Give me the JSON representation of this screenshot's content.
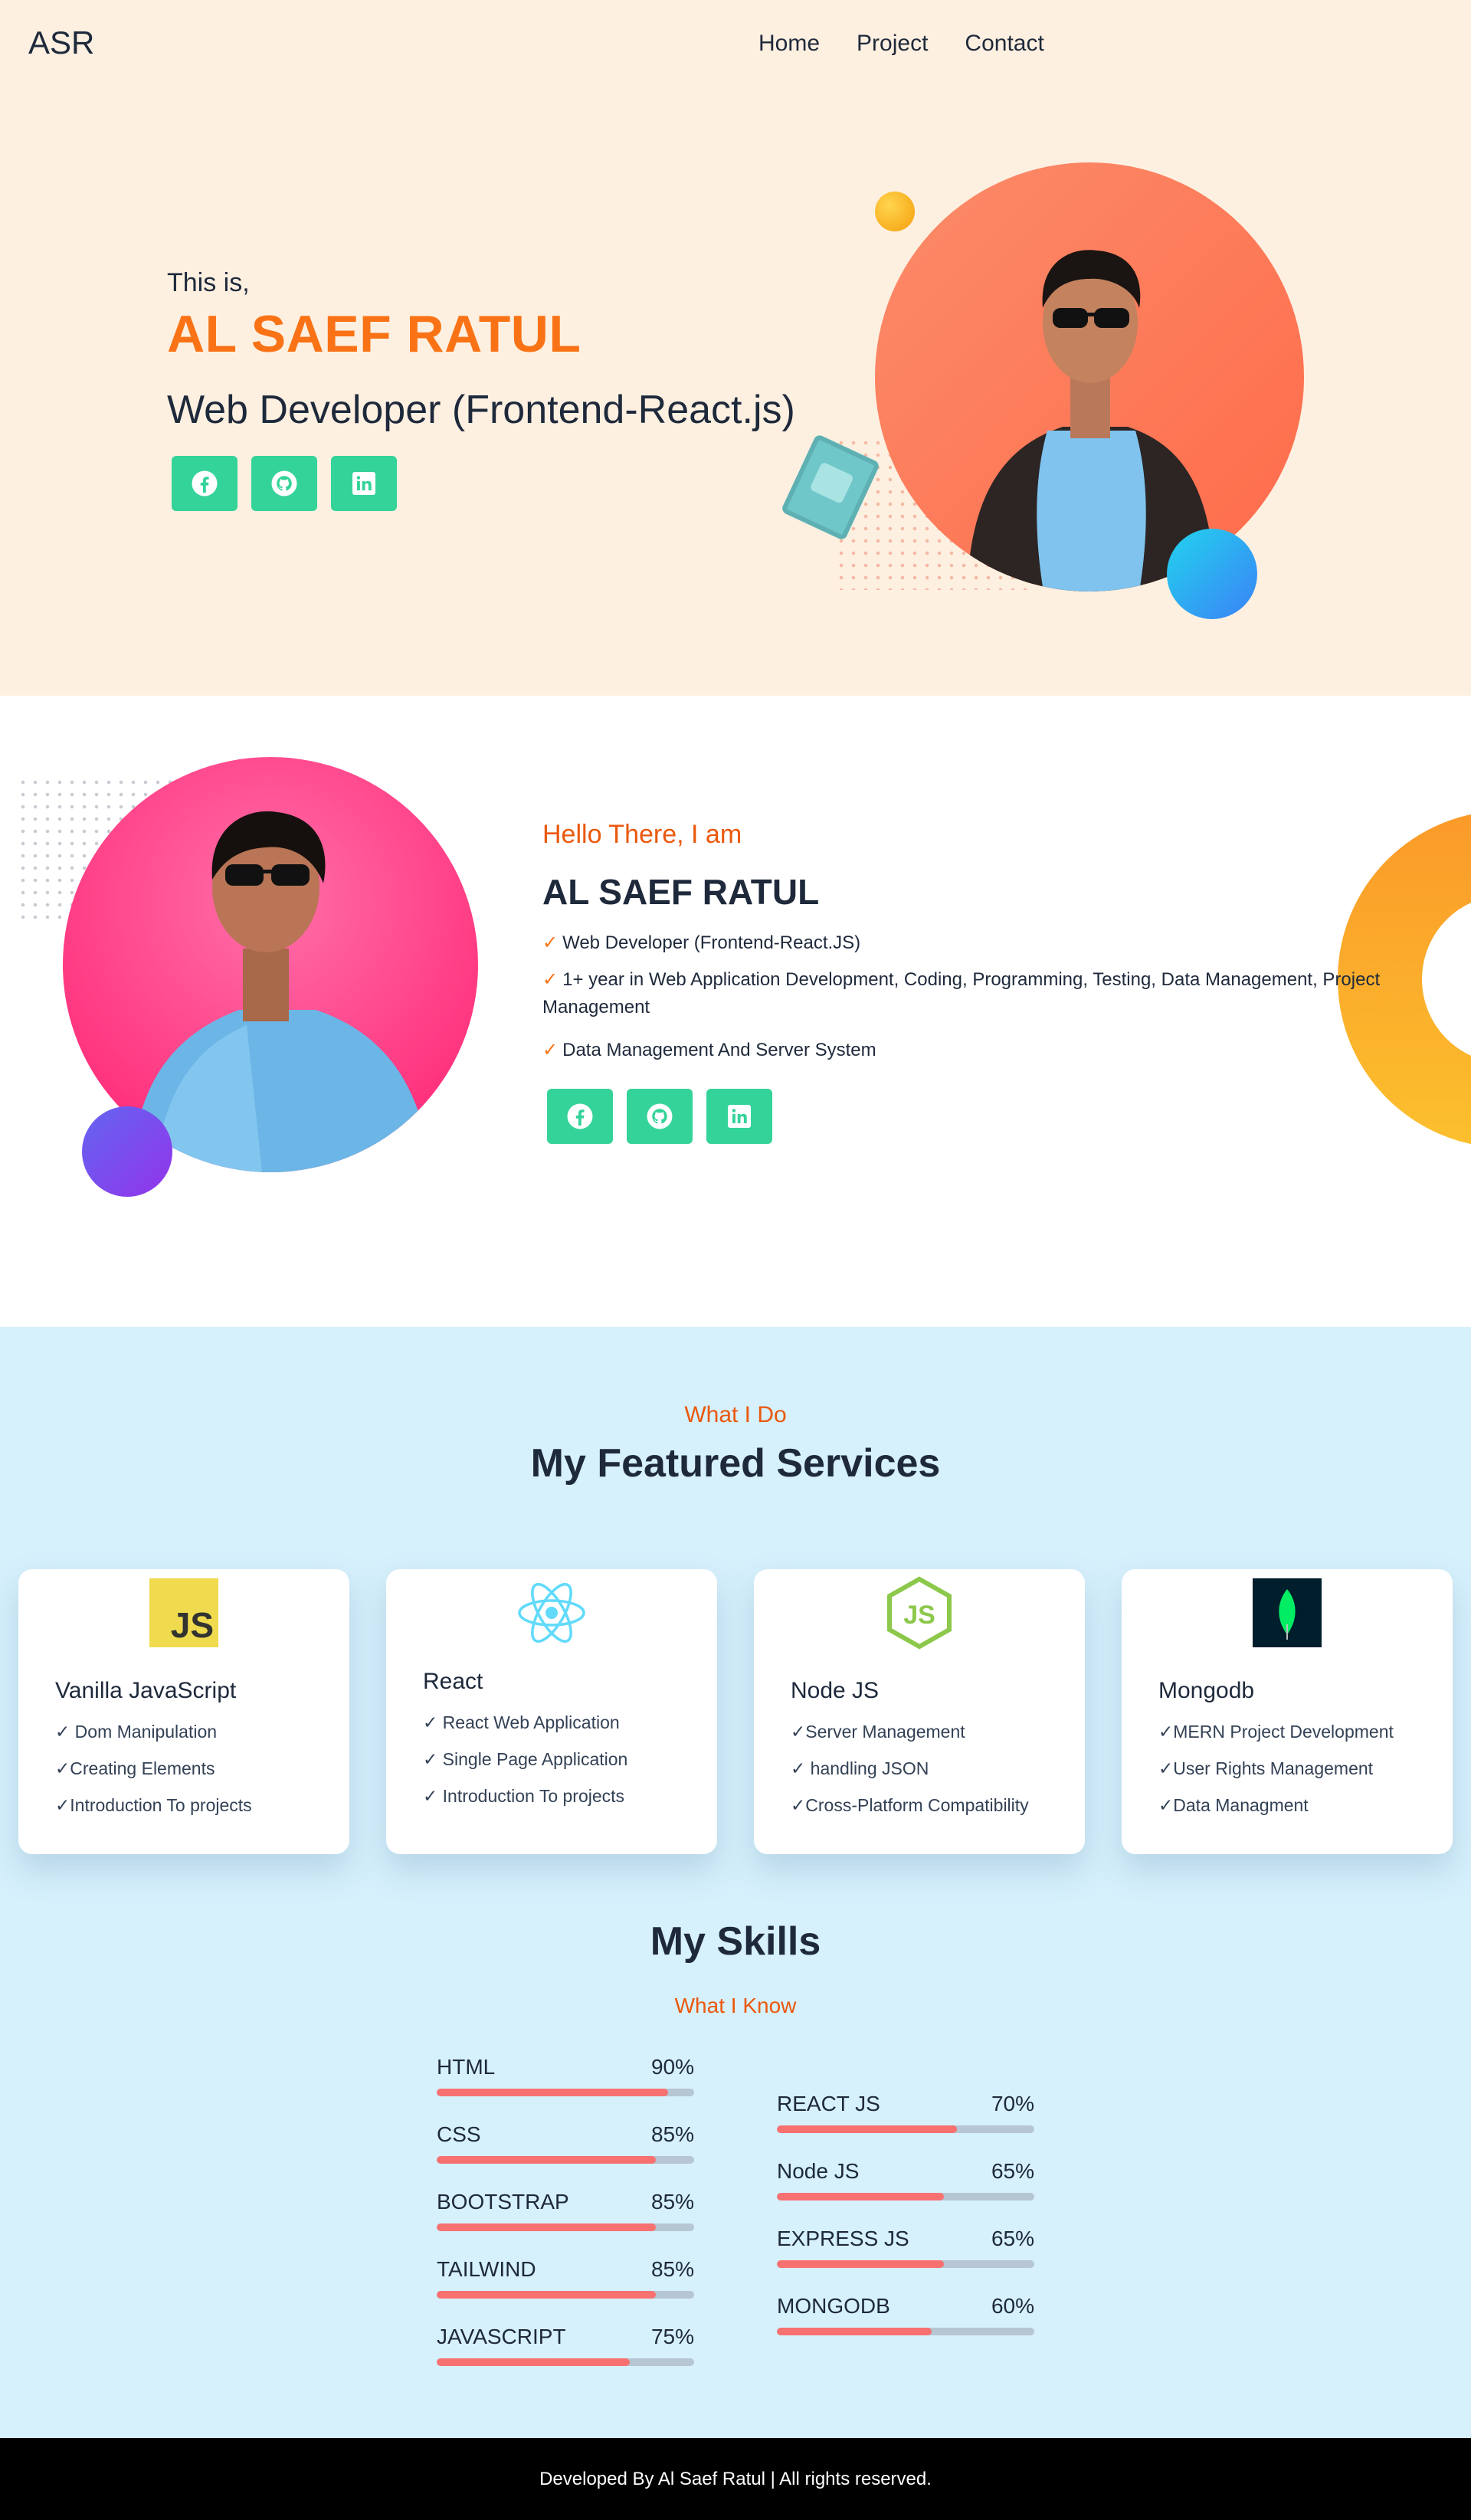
{
  "header": {
    "logo": "ASR",
    "nav": [
      {
        "label": "Home"
      },
      {
        "label": "Project"
      },
      {
        "label": "Contact"
      }
    ]
  },
  "hero": {
    "intro": "This is,",
    "name": "AL SAEF RATUL",
    "role": "Web Developer (Frontend-React.js)",
    "social": [
      "facebook-icon",
      "github-icon",
      "linkedin-icon"
    ]
  },
  "about": {
    "greeting": "Hello There, I am",
    "name": "AL SAEF RATUL",
    "check": "✓",
    "points": [
      "Web Developer (Frontend-React.JS)",
      "1+ year in Web Application Development, Coding, Programming, Testing, Data Management, Project Management",
      "Data Management And Server System"
    ]
  },
  "services": {
    "subtitle": "What I Do",
    "title": "My Featured Services",
    "cards": [
      {
        "icon": "javascript-icon",
        "title": "Vanilla JavaScript",
        "items": [
          "✓ Dom Manipulation",
          "✓Creating Elements",
          "✓Introduction To projects"
        ]
      },
      {
        "icon": "react-icon",
        "title": "React",
        "items": [
          "✓ React Web Application",
          "✓ Single Page Application",
          "✓ Introduction To projects"
        ]
      },
      {
        "icon": "nodejs-icon",
        "title": "Node JS",
        "items": [
          "✓Server Management",
          "✓ handling JSON",
          "✓Cross-Platform Compatibility"
        ]
      },
      {
        "icon": "mongodb-icon",
        "title": "Mongodb",
        "items": [
          "✓MERN Project Development",
          "✓User Rights Management",
          "✓Data Managment"
        ]
      }
    ],
    "js_icon_text": "JS"
  },
  "skills": {
    "title": "My Skills",
    "subtitle": "What I Know",
    "left": [
      {
        "name": "HTML",
        "value": 90,
        "label": "90%"
      },
      {
        "name": "CSS",
        "value": 85,
        "label": "85%"
      },
      {
        "name": "BOOTSTRAP",
        "value": 85,
        "label": "85%"
      },
      {
        "name": "TAILWIND",
        "value": 85,
        "label": "85%"
      },
      {
        "name": "JAVASCRIPT",
        "value": 75,
        "label": "75%"
      }
    ],
    "right": [
      {
        "name": "REACT JS",
        "value": 70,
        "label": "70%"
      },
      {
        "name": "Node JS",
        "value": 65,
        "label": "65%"
      },
      {
        "name": "EXPRESS JS",
        "value": 65,
        "label": "65%"
      },
      {
        "name": "MONGODB",
        "value": 60,
        "label": "60%"
      }
    ]
  },
  "footer": {
    "text": "Developed By Al Saef Ratul | All rights reserved."
  },
  "colors": {
    "accent": "#f97316",
    "social_button": "#34d399",
    "skill_fill": "#f87171"
  }
}
